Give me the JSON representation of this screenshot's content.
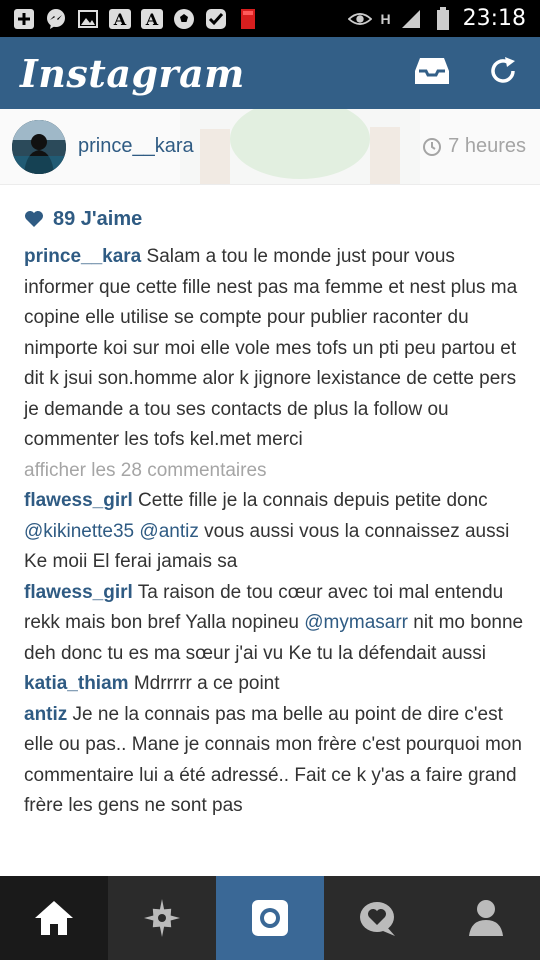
{
  "status_bar": {
    "time": "23:18",
    "network_label": "H"
  },
  "header": {
    "logo_text": "Instagram"
  },
  "post": {
    "username": "prince__kara",
    "time_ago": "7 heures",
    "likes_label": "89 J'aime",
    "caption_user": "prince__kara",
    "caption_text": " Salam a tou le monde just pour vous informer que cette fille nest pas ma femme et nest plus ma copine elle utilise se compte pour publier raconter du nimporte koi sur moi elle  vole mes tofs un pti peu partou et dit k jsui son.homme alor k jignore lexistance de cette pers je demande a tou ses contacts de plus la follow ou commenter les tofs kel.met merci",
    "view_all_comments": "afficher les 28 commentaires"
  },
  "comments": [
    {
      "user": "flawess_girl",
      "text1": " Cette fille je la connais depuis petite donc ",
      "mention1": "@kikinette35",
      "text2": "  ",
      "mention2": "@antiz",
      "text3": "  vous aussi vous la connaissez aussi Ke moii El ferai jamais sa"
    },
    {
      "user": "flawess_girl",
      "text1": " Ta raison de tou cœur avec toi mal entendu rekk mais bon bref Yalla nopineu ",
      "mention1": "@mymasarr",
      "text2": "  nit mo bonne deh donc tu es ma sœur j'ai vu Ke tu la défendait aussi"
    },
    {
      "user": "katia_thiam",
      "text1": " Mdrrrrr a ce point"
    },
    {
      "user": "antiz",
      "text1": " Je ne la connais pas ma belle au point de dire c'est elle ou pas.. Mane je connais mon frère c'est pourquoi mon commentaire lui a été adressé.. Fait ce k y'as a faire grand frère les gens ne sont pas"
    }
  ],
  "colors": {
    "header_bg": "#335f87",
    "link_blue": "#2f5b83",
    "muted_gray": "#a5a5a5",
    "nav_bg": "#2b2b2b",
    "nav_active_camera": "#3a6896"
  }
}
